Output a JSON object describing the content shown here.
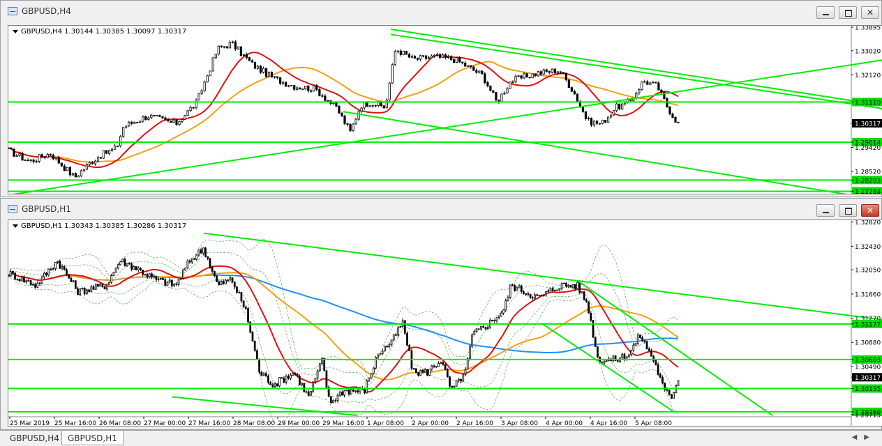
{
  "windows": [
    {
      "title": "GBPUSD,H4",
      "info": "GBPUSD,H4  1.30144 1.30385 1.30097 1.30317",
      "close_active": false,
      "price_labels": [
        "1.33895",
        "1.33020",
        "1.32120",
        "1.31110",
        "1.30317",
        "1.29614",
        "1.29420",
        "1.28520",
        "1.28203",
        "1.27784",
        "1.27645"
      ],
      "price_levels": [
        1.33895,
        1.3302,
        1.3212,
        1.3111,
        1.30317,
        1.29614,
        1.2942,
        1.2852,
        1.28203,
        1.27784,
        1.27645
      ],
      "highlight_labels": [
        "1.31110",
        "1.29614",
        "1.28203",
        "1.27784"
      ],
      "current": "1.30317",
      "ymin": 1.2764,
      "ymax": 1.3395,
      "hlines": [
        1.3111,
        1.29614,
        1.28203,
        1.27784
      ],
      "trendlines": [
        [
          [
            548,
            1.3382
          ],
          [
            1264,
            1.3094
          ]
        ],
        [
          [
            548,
            1.3363
          ],
          [
            1264,
            1.3082
          ]
        ],
        [
          [
            0,
            1.2764
          ],
          [
            1264,
            1.3272
          ]
        ],
        [
          [
            480,
            1.3075
          ],
          [
            1264,
            1.274
          ]
        ]
      ],
      "candles": 240,
      "anchors": [
        [
          0,
          1.293
        ],
        [
          30,
          1.289
        ],
        [
          60,
          1.292
        ],
        [
          95,
          1.283
        ],
        [
          115,
          1.288
        ],
        [
          130,
          1.291
        ],
        [
          155,
          1.294
        ],
        [
          165,
          1.302
        ],
        [
          200,
          1.306
        ],
        [
          240,
          1.303
        ],
        [
          270,
          1.311
        ],
        [
          300,
          1.331
        ],
        [
          320,
          1.333
        ],
        [
          350,
          1.325
        ],
        [
          380,
          1.32
        ],
        [
          410,
          1.317
        ],
        [
          440,
          1.316
        ],
        [
          470,
          1.309
        ],
        [
          490,
          1.3
        ],
        [
          505,
          1.31
        ],
        [
          520,
          1.311
        ],
        [
          540,
          1.309
        ],
        [
          555,
          1.331
        ],
        [
          580,
          1.327
        ],
        [
          610,
          1.328
        ],
        [
          640,
          1.327
        ],
        [
          680,
          1.321
        ],
        [
          700,
          1.311
        ],
        [
          720,
          1.319
        ],
        [
          760,
          1.322
        ],
        [
          790,
          1.323
        ],
        [
          810,
          1.315
        ],
        [
          830,
          1.304
        ],
        [
          850,
          1.303
        ],
        [
          870,
          1.309
        ],
        [
          890,
          1.311
        ],
        [
          910,
          1.319
        ],
        [
          930,
          1.317
        ],
        [
          945,
          1.309
        ],
        [
          960,
          1.303
        ]
      ],
      "mas": [
        {
          "color": "#e01010",
          "period": 16
        },
        {
          "color": "#f5a010",
          "period": 36
        }
      ],
      "bands": false
    },
    {
      "title": "GBPUSD,H1",
      "info": "GBPUSD,H1  1.30343 1.30385 1.30286 1.30317",
      "close_active": true,
      "price_labels": [
        "1.32820",
        "1.32430",
        "1.32050",
        "1.31660",
        "1.31270",
        "1.31177",
        "1.30880",
        "1.30603",
        "1.30490",
        "1.30317",
        "1.30135",
        "1.29760",
        "1.29715"
      ],
      "price_levels": [
        1.3282,
        1.3243,
        1.3205,
        1.3166,
        1.3127,
        1.31177,
        1.3088,
        1.30603,
        1.3049,
        1.30317,
        1.30135,
        1.2976,
        1.29715
      ],
      "highlight_labels": [
        "1.31177",
        "1.30603",
        "1.30135",
        "1.29760"
      ],
      "current": "1.30317",
      "ymin": 1.2968,
      "ymax": 1.3285,
      "hlines": [
        1.31177,
        1.30603,
        1.30135,
        1.2976
      ],
      "trendlines": [
        [
          [
            280,
            1.3264
          ],
          [
            1264,
            1.3123
          ]
        ],
        [
          [
            235,
            1.3
          ],
          [
            500,
            1.297
          ]
        ],
        [
          [
            815,
            1.3188
          ],
          [
            1095,
            1.297
          ]
        ],
        [
          [
            765,
            1.3118
          ],
          [
            955,
            1.2975
          ]
        ]
      ],
      "candles": 300,
      "anchors": [
        [
          0,
          1.32
        ],
        [
          40,
          1.318
        ],
        [
          70,
          1.322
        ],
        [
          100,
          1.317
        ],
        [
          140,
          1.318
        ],
        [
          160,
          1.322
        ],
        [
          180,
          1.321
        ],
        [
          210,
          1.319
        ],
        [
          240,
          1.318
        ],
        [
          260,
          1.322
        ],
        [
          280,
          1.324
        ],
        [
          300,
          1.318
        ],
        [
          320,
          1.319
        ],
        [
          340,
          1.314
        ],
        [
          360,
          1.304
        ],
        [
          380,
          1.302
        ],
        [
          410,
          1.304
        ],
        [
          430,
          1.3
        ],
        [
          450,
          1.306
        ],
        [
          460,
          1.299
        ],
        [
          480,
          1.301
        ],
        [
          510,
          1.301
        ],
        [
          530,
          1.307
        ],
        [
          550,
          1.309
        ],
        [
          565,
          1.312
        ],
        [
          580,
          1.304
        ],
        [
          600,
          1.304
        ],
        [
          620,
          1.306
        ],
        [
          635,
          1.301
        ],
        [
          655,
          1.304
        ],
        [
          665,
          1.31
        ],
        [
          690,
          1.312
        ],
        [
          710,
          1.314
        ],
        [
          720,
          1.318
        ],
        [
          740,
          1.317
        ],
        [
          760,
          1.316
        ],
        [
          790,
          1.318
        ],
        [
          815,
          1.318
        ],
        [
          830,
          1.315
        ],
        [
          845,
          1.306
        ],
        [
          870,
          1.306
        ],
        [
          890,
          1.307
        ],
        [
          905,
          1.31
        ],
        [
          925,
          1.306
        ],
        [
          940,
          1.301
        ],
        [
          950,
          1.3
        ],
        [
          960,
          1.303
        ]
      ],
      "mas": [
        {
          "color": "#e01010",
          "period": 20
        },
        {
          "color": "#f5a010",
          "period": 60
        },
        {
          "color": "#1e90ff",
          "period": 140
        }
      ],
      "bands": true
    }
  ],
  "time_axis": [
    "25 Mar 2019",
    "25 Mar 16:00",
    "26 Mar 08:00",
    "27 Mar 00:00",
    "27 Mar 16:00",
    "28 Mar 08:00",
    "29 Mar 00:00",
    "29 Mar 16:00",
    "1 Apr 08:00",
    "2 Apr 00:00",
    "2 Apr 16:00",
    "3 Apr 08:00",
    "4 Apr 00:00",
    "4 Apr 16:00",
    "5 Apr 08:00"
  ],
  "tabs": [
    {
      "label": "GBPUSD,H4",
      "active": false
    },
    {
      "label": "GBPUSD,H1",
      "active": true
    }
  ],
  "colors": {
    "bull": "#000000",
    "bear": "#000000",
    "level": "#00ee00",
    "label_bg": "#00dd00",
    "current_bg": "#000000"
  }
}
